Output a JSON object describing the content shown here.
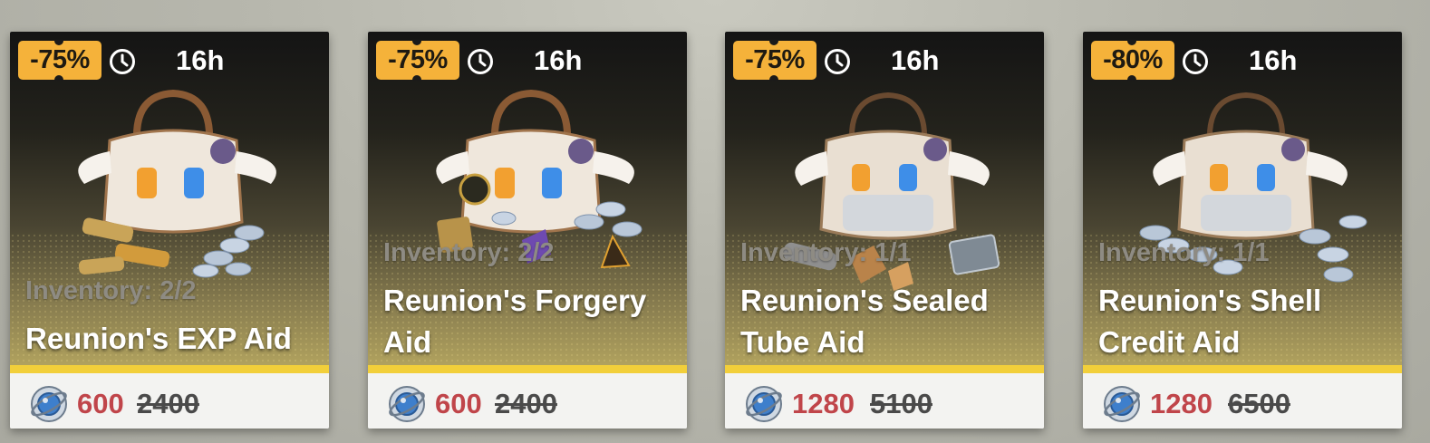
{
  "colors": {
    "discount_badge": "#f5b23a",
    "accent_bar": "#f2cf3a",
    "price_now": "#c0454a",
    "price_old": "#4a4a4a"
  },
  "icons": {
    "timer": "clock-icon",
    "currency": "globe-currency-icon",
    "item_art": "bag-bundle-icon"
  },
  "cards": [
    {
      "discount": "-75%",
      "time_left": "16h",
      "inventory": "Inventory: 2/2",
      "name_line1": "Reunion's EXP Aid",
      "name_line2": "",
      "price_now": "600",
      "price_old": "2400"
    },
    {
      "discount": "-75%",
      "time_left": "16h",
      "inventory": "Inventory: 2/2",
      "name_line1": "Reunion's Forgery",
      "name_line2": "Aid",
      "price_now": "600",
      "price_old": "2400"
    },
    {
      "discount": "-75%",
      "time_left": "16h",
      "inventory": "Inventory: 1/1",
      "name_line1": "Reunion's Sealed",
      "name_line2": "Tube Aid",
      "price_now": "1280",
      "price_old": "5100"
    },
    {
      "discount": "-80%",
      "time_left": "16h",
      "inventory": "Inventory: 1/1",
      "name_line1": "Reunion's Shell",
      "name_line2": "Credit Aid",
      "price_now": "1280",
      "price_old": "6500"
    }
  ]
}
